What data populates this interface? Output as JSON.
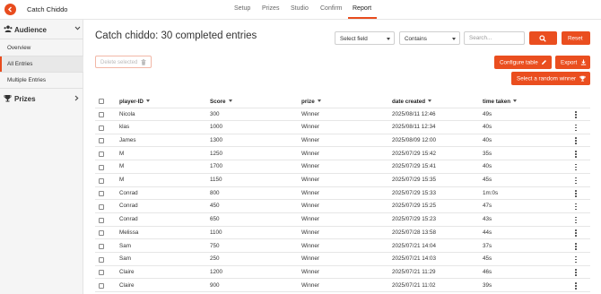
{
  "app": {
    "title": "Catch Chiddo"
  },
  "nav": {
    "tabs": [
      "Setup",
      "Prizes",
      "Studio",
      "Confirm",
      "Report"
    ],
    "active": "Report"
  },
  "sidebar": {
    "audience_label": "Audience",
    "items": [
      "Overview",
      "All Entries",
      "Multiple Entries"
    ],
    "active_item": "All Entries",
    "prizes_label": "Prizes"
  },
  "main": {
    "title": "Catch chiddo: 30 completed entries",
    "filters": {
      "field_select": "Select field",
      "operator_select": "Contains",
      "search_placeholder": "Search..."
    },
    "buttons": {
      "reset": "Reset",
      "delete_selected": "Delete selected",
      "configure_table": "Configure table",
      "export": "Export",
      "random_winner": "Select a random winner"
    },
    "table": {
      "columns": [
        "player-ID",
        "Score",
        "prize",
        "date created",
        "time taken"
      ],
      "rows": [
        [
          "Nicola",
          "300",
          "Winner",
          "2025/08/11 12:46",
          "49s"
        ],
        [
          "klas",
          "1000",
          "Winner",
          "2025/08/11 12:34",
          "40s"
        ],
        [
          "James",
          "1300",
          "Winner",
          "2025/08/09 12:00",
          "40s"
        ],
        [
          "M",
          "1250",
          "Winner",
          "2025/07/29 15:42",
          "35s"
        ],
        [
          "M",
          "1700",
          "Winner",
          "2025/07/29 15:41",
          "40s"
        ],
        [
          "M",
          "1150",
          "Winner",
          "2025/07/29 15:35",
          "45s"
        ],
        [
          "Conrad",
          "800",
          "Winner",
          "2025/07/29 15:33",
          "1m:0s"
        ],
        [
          "Conrad",
          "450",
          "Winner",
          "2025/07/29 15:25",
          "47s"
        ],
        [
          "Conrad",
          "650",
          "Winner",
          "2025/07/29 15:23",
          "43s"
        ],
        [
          "Melissa",
          "1100",
          "Winner",
          "2025/07/28 13:58",
          "44s"
        ],
        [
          "Sam",
          "750",
          "Winner",
          "2025/07/21 14:04",
          "37s"
        ],
        [
          "Sam",
          "250",
          "Winner",
          "2025/07/21 14:03",
          "45s"
        ],
        [
          "Claire",
          "1200",
          "Winner",
          "2025/07/21 11:29",
          "46s"
        ],
        [
          "Claire",
          "900",
          "Winner",
          "2025/07/21 11:02",
          "39s"
        ]
      ]
    }
  },
  "colors": {
    "accent": "#ea4e1f",
    "sidebar_bg": "#f5f5f5"
  },
  "icons": [
    "logo-icon",
    "audience-icon",
    "chevron-down-icon",
    "trophy-icon",
    "chevron-right-icon",
    "search-icon",
    "trash-icon",
    "pencil-icon",
    "download-icon",
    "kebab-icon"
  ]
}
